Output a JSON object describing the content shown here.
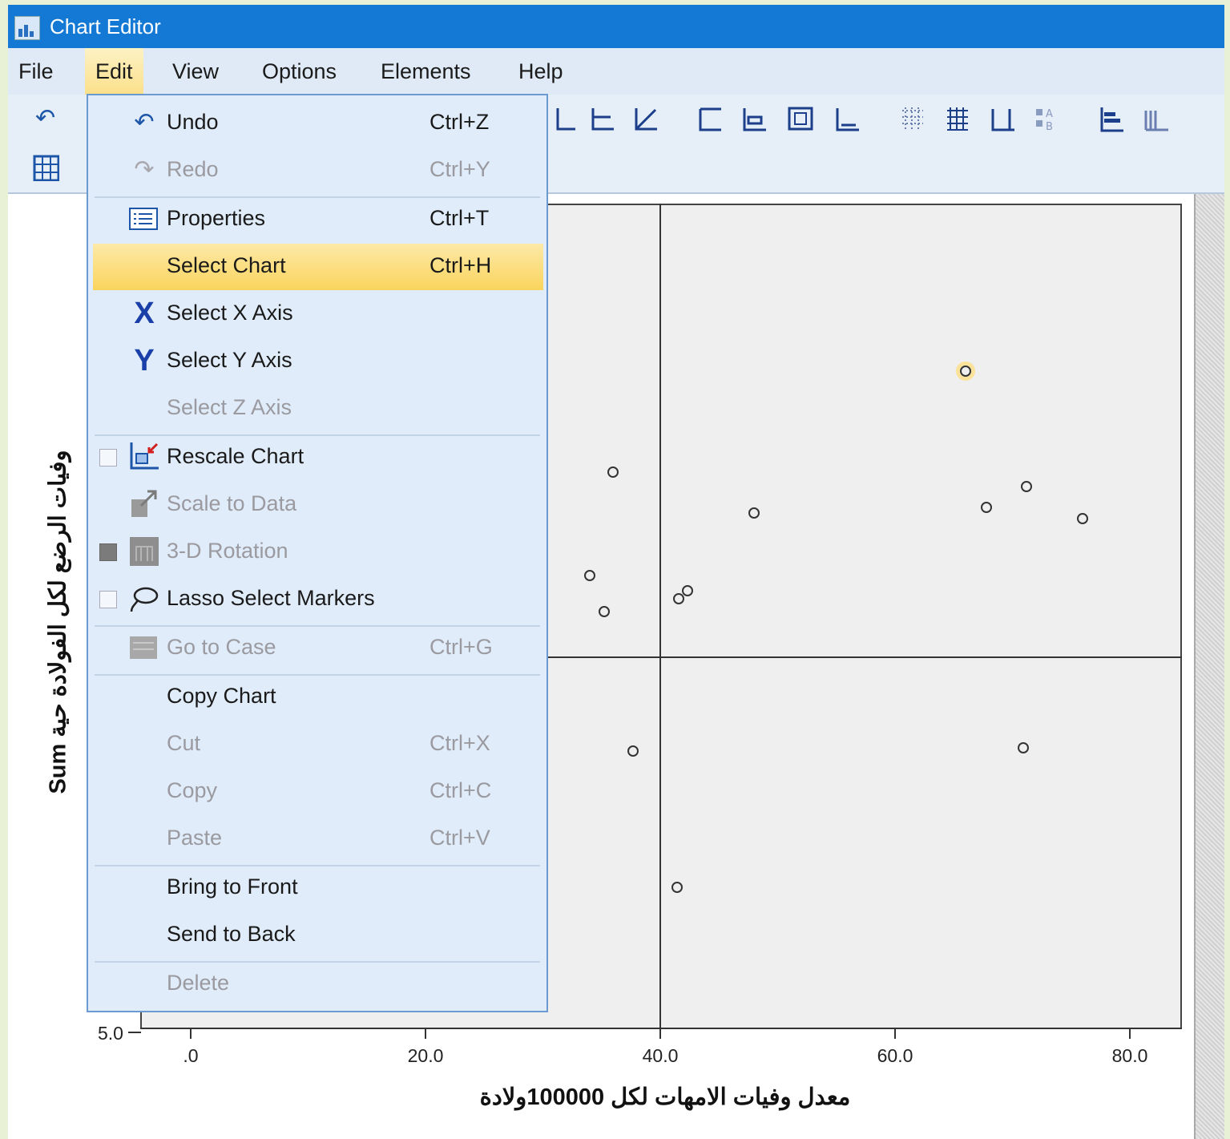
{
  "window": {
    "title": "Chart Editor"
  },
  "menubar": [
    "File",
    "Edit",
    "View",
    "Options",
    "Elements",
    "Help"
  ],
  "edit_menu": {
    "items": [
      {
        "label": "Undo",
        "shortcut": "Ctrl+Z",
        "enabled": true,
        "icon": "undo-icon"
      },
      {
        "label": "Redo",
        "shortcut": "Ctrl+Y",
        "enabled": false,
        "icon": "redo-icon"
      },
      {
        "label": "Properties",
        "shortcut": "Ctrl+T",
        "enabled": true,
        "icon": "properties-icon"
      },
      {
        "label": "Select Chart",
        "shortcut": "Ctrl+H",
        "enabled": true,
        "highlighted": true
      },
      {
        "label": "Select X Axis",
        "shortcut": "",
        "enabled": true,
        "icon": "x-axis-icon"
      },
      {
        "label": "Select Y Axis",
        "shortcut": "",
        "enabled": true,
        "icon": "y-axis-icon"
      },
      {
        "label": "Select Z Axis",
        "shortcut": "",
        "enabled": false
      },
      {
        "label": "Rescale Chart",
        "shortcut": "",
        "enabled": true,
        "icon": "rescale-chart-icon"
      },
      {
        "label": "Scale to Data",
        "shortcut": "",
        "enabled": false,
        "icon": "scale-to-data-icon"
      },
      {
        "label": "3-D Rotation",
        "shortcut": "",
        "enabled": false,
        "icon": "3d-rotation-icon"
      },
      {
        "label": "Lasso Select Markers",
        "shortcut": "",
        "enabled": true,
        "icon": "lasso-icon"
      },
      {
        "label": "Go to Case",
        "shortcut": "Ctrl+G",
        "enabled": false,
        "icon": "go-to-case-icon"
      },
      {
        "label": "Copy Chart",
        "shortcut": "",
        "enabled": true
      },
      {
        "label": "Cut",
        "shortcut": "Ctrl+X",
        "enabled": false
      },
      {
        "label": "Copy",
        "shortcut": "Ctrl+C",
        "enabled": false
      },
      {
        "label": "Paste",
        "shortcut": "Ctrl+V",
        "enabled": false
      },
      {
        "label": "Bring to Front",
        "shortcut": "",
        "enabled": true
      },
      {
        "label": "Send to Back",
        "shortcut": "",
        "enabled": true
      },
      {
        "label": "Delete",
        "shortcut": "",
        "enabled": false
      }
    ]
  },
  "chart_data": {
    "type": "scatter",
    "xlabel": "معدل وفيات الامهات لكل 100000ولادة",
    "ylabel": "وفيات الرضع لكل الفولادة حية Sum",
    "x_ticks": [
      ".0",
      "20.0",
      "40.0",
      "60.0",
      "80.0"
    ],
    "y_ticks_visible": [
      "5.0"
    ],
    "reference_lines": {
      "x": 40.0
    },
    "points": [
      {
        "x": 66.0,
        "highlighted": true
      },
      {
        "x": 36.0
      },
      {
        "x": 48.0
      },
      {
        "x": 67.8
      },
      {
        "x": 71.2
      },
      {
        "x": 76.0
      },
      {
        "x": 34.0
      },
      {
        "x": 35.2
      },
      {
        "x": 41.6
      },
      {
        "x": 42.3
      },
      {
        "x": 37.7
      },
      {
        "x": 70.9
      },
      {
        "x": 41.4
      }
    ]
  }
}
